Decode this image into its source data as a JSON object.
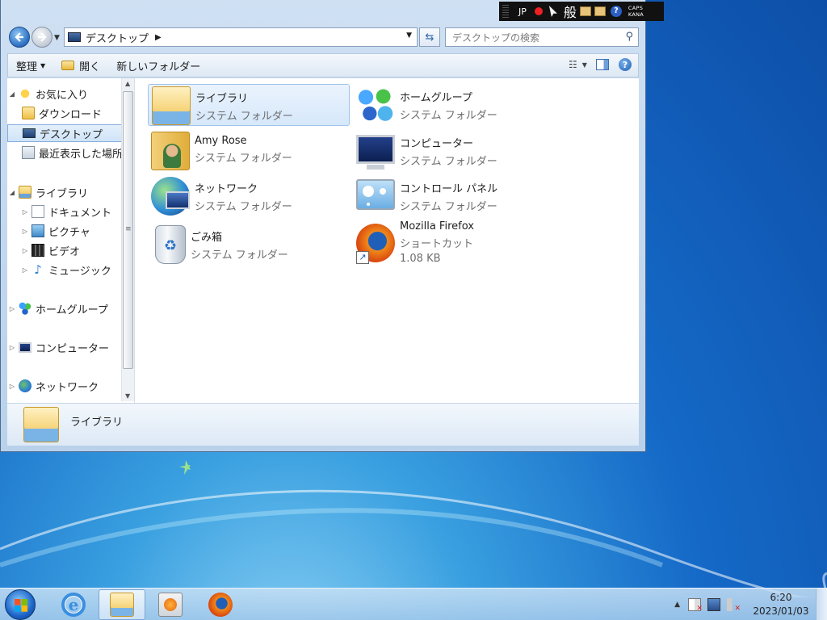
{
  "language_bar": {
    "lang": "JP",
    "mode": "般",
    "caps": "CAPS",
    "kana": "KANA"
  },
  "address_bar": {
    "path": "デスクトップ",
    "search_placeholder": "デスクトップの検索"
  },
  "command_bar": {
    "organize": "整理",
    "open": "開く",
    "new_folder": "新しいフォルダー"
  },
  "nav_pane": {
    "favorites": "お気に入り",
    "downloads": "ダウンロード",
    "desktop": "デスクトップ",
    "recent": "最近表示した場所",
    "libraries": "ライブラリ",
    "documents": "ドキュメント",
    "pictures": "ピクチャ",
    "videos": "ビデオ",
    "music": "ミュージック",
    "homegroup": "ホームグループ",
    "computer": "コンピューター",
    "network": "ネットワーク"
  },
  "items": [
    {
      "name": "ライブラリ",
      "type": "システム フォルダー",
      "icon": "library-icon",
      "selected": true
    },
    {
      "name": "ホームグループ",
      "type": "システム フォルダー",
      "icon": "homegroup-icon"
    },
    {
      "name": "Amy Rose",
      "type": "システム フォルダー",
      "icon": "user-folder-icon"
    },
    {
      "name": "コンピューター",
      "type": "システム フォルダー",
      "icon": "computer-icon"
    },
    {
      "name": "ネットワーク",
      "type": "システム フォルダー",
      "icon": "network-icon"
    },
    {
      "name": "コントロール パネル",
      "type": "システム フォルダー",
      "icon": "control-panel-icon"
    },
    {
      "name": "ごみ箱",
      "type": "システム フォルダー",
      "icon": "recycle-bin-icon"
    },
    {
      "name": "Mozilla Firefox",
      "type": "ショートカット",
      "size": "1.08 KB",
      "icon": "firefox-icon"
    }
  ],
  "details_pane": {
    "selected_name": "ライブラリ"
  },
  "taskbar": {
    "time": "6:20",
    "date": "2023/01/03"
  }
}
